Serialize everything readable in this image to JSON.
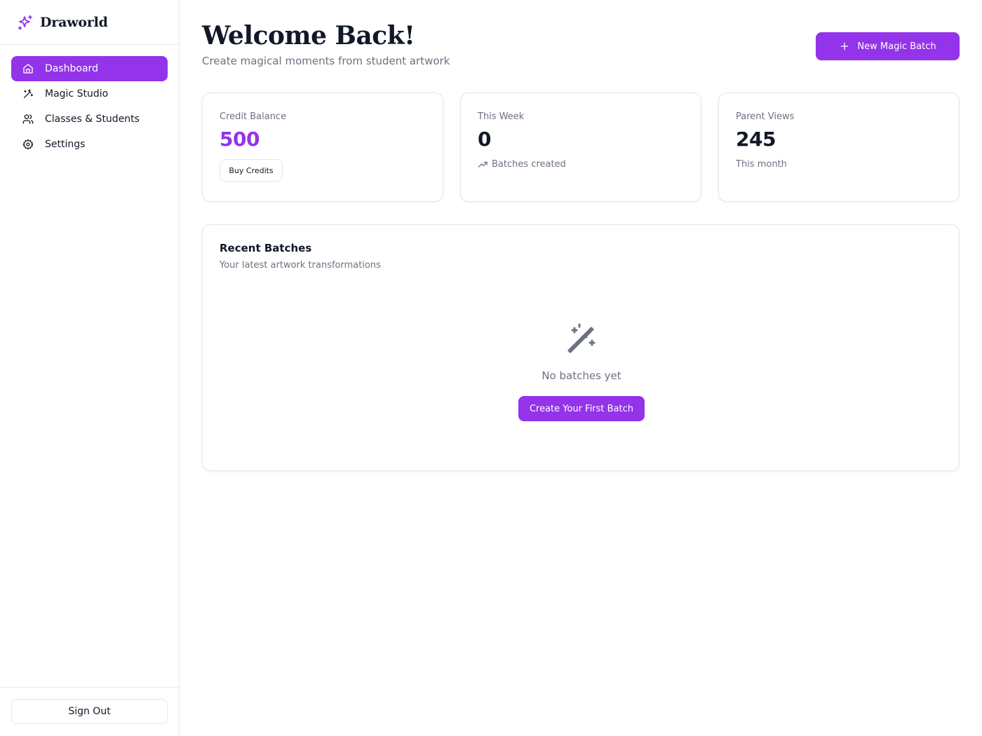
{
  "brand": {
    "name": "Draworld",
    "icon": "sparkles-icon",
    "accent_color": "#9333ea"
  },
  "sidebar": {
    "items": [
      {
        "label": "Dashboard",
        "icon": "home-icon",
        "active": true
      },
      {
        "label": "Magic Studio",
        "icon": "magic-wand-icon",
        "active": false
      },
      {
        "label": "Classes & Students",
        "icon": "users-icon",
        "active": false
      },
      {
        "label": "Settings",
        "icon": "gear-icon",
        "active": false
      }
    ],
    "sign_out_label": "Sign Out"
  },
  "header": {
    "title": "Welcome Back!",
    "subtitle": "Create magical moments from student artwork",
    "new_batch_label": "New Magic Batch",
    "new_batch_icon": "plus-icon"
  },
  "stats": {
    "credit": {
      "label": "Credit Balance",
      "value": "500",
      "button_label": "Buy Credits"
    },
    "week": {
      "label": "This Week",
      "value": "0",
      "foot": "Batches created",
      "foot_icon": "trending-up-icon"
    },
    "views": {
      "label": "Parent Views",
      "value": "245",
      "foot": "This month"
    }
  },
  "recent": {
    "title": "Recent Batches",
    "subtitle": "Your latest artwork transformations",
    "empty_icon": "magic-wand-icon",
    "empty_text": "No batches yet",
    "create_label": "Create Your First Batch"
  }
}
